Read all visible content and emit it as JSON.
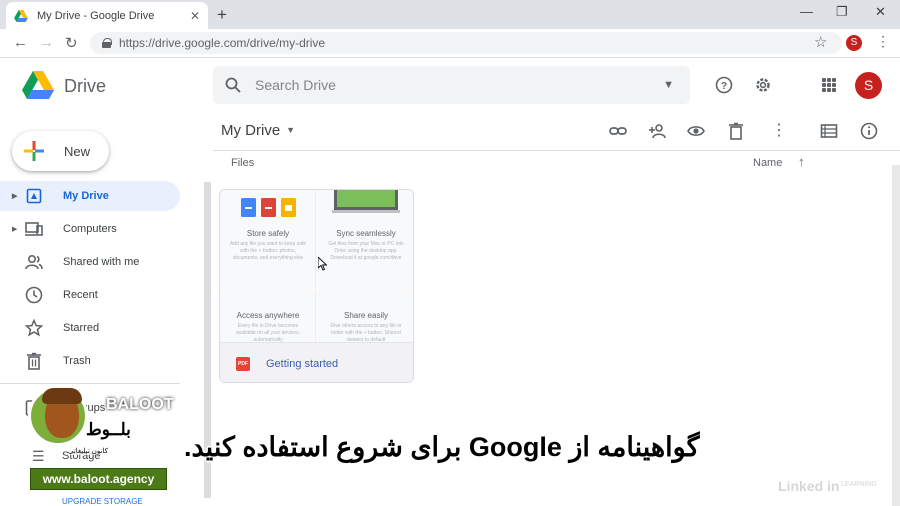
{
  "browser": {
    "tab_title": "My Drive - Google Drive",
    "tab_close": "✕",
    "new_tab": "+",
    "url": "https://drive.google.com/drive/my-drive",
    "profile_initial": "S"
  },
  "header": {
    "product_name": "Drive",
    "search_placeholder": "Search Drive",
    "avatar_initial": "S"
  },
  "sidebar": {
    "new_label": "New",
    "items": [
      {
        "label": "My Drive",
        "icon": "my-drive-icon",
        "active": true
      },
      {
        "label": "Computers",
        "icon": "computers-icon",
        "active": false
      },
      {
        "label": "Shared with me",
        "icon": "people-icon",
        "active": false
      },
      {
        "label": "Recent",
        "icon": "clock-icon",
        "active": false
      },
      {
        "label": "Starred",
        "icon": "star-icon",
        "active": false
      },
      {
        "label": "Trash",
        "icon": "trash-icon",
        "active": false
      },
      {
        "label": "Backups",
        "icon": "backup-icon",
        "active": false
      }
    ],
    "storage_label": "Storage",
    "upgrade_label": "UPGRADE STORAGE"
  },
  "main": {
    "title": "My Drive",
    "section_label": "Files",
    "sort_label": "Name",
    "card": {
      "quadrants": [
        {
          "title": "Store safely",
          "text": "Add any file you want to keep safe with the + button: photos, documents, and everything else"
        },
        {
          "title": "Sync seamlessly",
          "text": "Get files from your Mac or PC into Drive using the desktop app. Download it at google.com/drive"
        },
        {
          "title": "Access anywhere",
          "text": "Every file in Drive becomes available on all your devices, automatically"
        },
        {
          "title": "Share easily",
          "text": "Give others access to any file or folder with the + button. Shared viewers to default"
        }
      ],
      "file_name": "Getting started",
      "file_type": "PDF"
    }
  },
  "overlay": {
    "subtitle": "گواهینامه از Google برای شروع استفاده کنید.",
    "watermark": "Linked in",
    "watermark_sub": "LEARNING",
    "brand_name": "BALOOT",
    "brand_fa": "بلــوط",
    "brand_tagline": "کانون تبلیغاتی",
    "brand_site": "www.baloot.agency"
  },
  "colors": {
    "accent": "#1967d2",
    "avatar": "#c5221f",
    "active_bg": "#e8f0fe"
  }
}
